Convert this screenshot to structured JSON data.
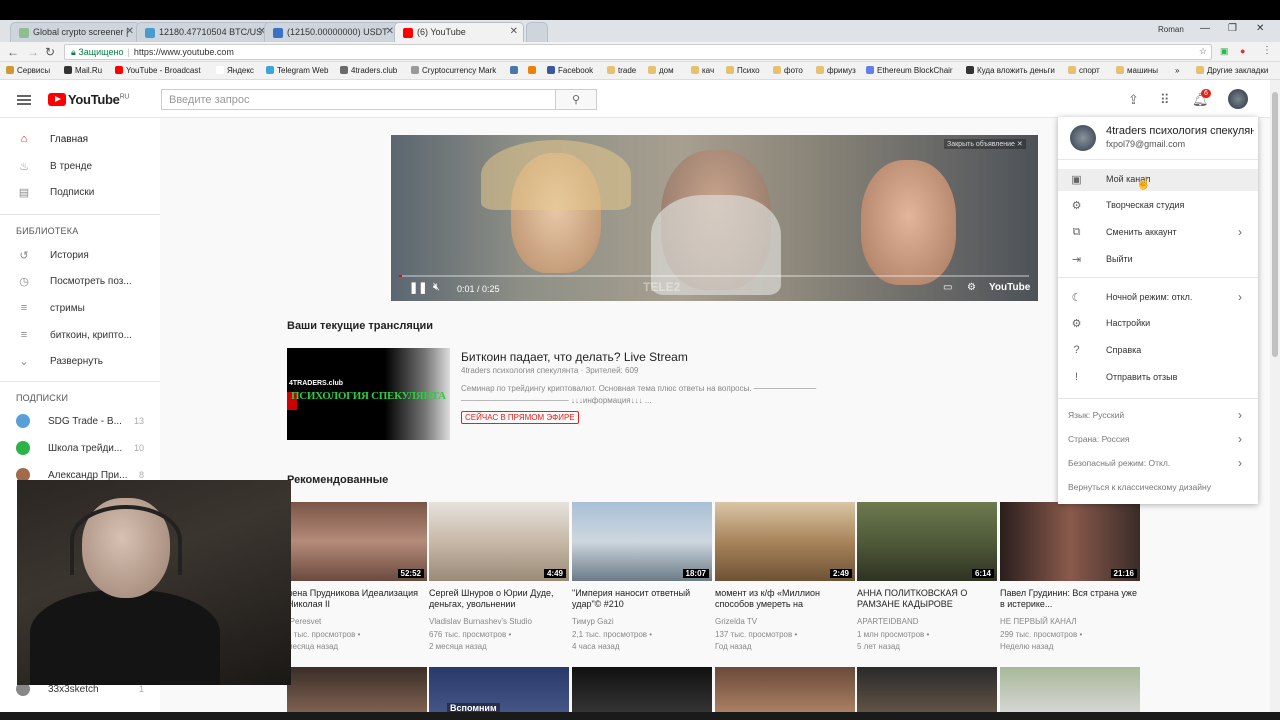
{
  "browser": {
    "tabs": [
      {
        "title": "Global crypto screener |",
        "color": "#8fbf8f"
      },
      {
        "title": "12180.47710504 BTC/US",
        "color": "#4a9bd1"
      },
      {
        "title": "(12150.00000000) USDT",
        "color": "#3b70c4"
      },
      {
        "title": "(6) YouTube",
        "color": "#ff0000"
      }
    ],
    "profile_label": "Roman",
    "url_secure": "Защищено",
    "url": "https://www.youtube.com",
    "bookmarks": [
      "Сервисы",
      "Mail.Ru",
      "YouTube - Broadcast",
      "Яндекс",
      "Telegram Web",
      "4traders.club",
      "Cryptocurrency Mark",
      "",
      "",
      "Facebook",
      "trade",
      "дом",
      "кач",
      "Психо",
      "фото",
      "фримуз",
      "Ethereum BlockChair",
      "Куда вложить деньги",
      "спорт",
      "машины",
      "»",
      "Другие закладки"
    ]
  },
  "header": {
    "logo": "YouTube",
    "logo_region": "RU",
    "search_placeholder": "Введите запрос",
    "notif_count": "6"
  },
  "sidebar": {
    "main": [
      {
        "label": "Главная",
        "icon": "home-icon",
        "active": true
      },
      {
        "label": "В тренде",
        "icon": "flame-icon"
      },
      {
        "label": "Подписки",
        "icon": "subscriptions-icon"
      }
    ],
    "library_heading": "БИБЛИОТЕКА",
    "library": [
      {
        "label": "История",
        "icon": "history-icon"
      },
      {
        "label": "Посмотреть поз...",
        "icon": "clock-icon"
      },
      {
        "label": "стримы",
        "icon": "playlist-icon"
      },
      {
        "label": "биткоин, крипто...",
        "icon": "playlist-icon"
      },
      {
        "label": "Развернуть",
        "icon": "chevron-down-icon"
      }
    ],
    "subs_heading": "ПОДПИСКИ",
    "subs": [
      {
        "label": "SDG Trade - B...",
        "count": "13",
        "color": "#5aa0d8"
      },
      {
        "label": "Школа трейди...",
        "count": "10",
        "color": "#2bb34a"
      },
      {
        "label": "Александр При...",
        "count": "8",
        "color": "#a06b4c"
      }
    ],
    "last_sub": {
      "label": "33x3sketch",
      "count": "1"
    }
  },
  "player": {
    "time": "0:01 / 0:25",
    "watermark": "TELE2",
    "ad_label": "Закрыть объявление",
    "brand": "YouTube"
  },
  "live_section": {
    "heading": "Ваши текущие трансляции",
    "thumb_top": "4TRADERS.club",
    "thumb_main": "ПСИХОЛОГИЯ СПЕКУЛЯНТА",
    "title": "Биткоин падает, что делать? Live Stream",
    "meta": "4traders психология спекулянта · Зрителей: 609",
    "desc": "Семинар по трейдингу криптовалют. Основная тема плюс ответы на вопросы. ─────────── ─────────────────── ↓↓↓информация↓↓↓ ...",
    "badge": "СЕЙЧАС В ПРЯМОМ ЭФИРЕ"
  },
  "recommended": {
    "heading": "Рекомендованные",
    "videos": [
      {
        "title": "лена Прудникова Идеализация Николая II",
        "channel": "rPeresvet",
        "views": "7 тыс. просмотров",
        "age": "месяца назад",
        "duration": "52:52",
        "thumb": "#8a5a4a"
      },
      {
        "title": "Сергей Шнуров о Юрии Дуде, деньгах, увольнении",
        "channel": "Vladislav Burnashev's Studio",
        "views": "676 тыс. просмотров",
        "age": "2 месяца назад",
        "duration": "4:49",
        "thumb": "#c9c2b8"
      },
      {
        "title": "\"Империя наносит ответный удар\"© #210",
        "channel": "Тимур Gazi",
        "views": "2,1 тыс. просмотров",
        "age": "4 часа назад",
        "duration": "18:07",
        "thumb": "#8ea6bf"
      },
      {
        "title": "момент из к/ф «Миллион способов умереть на",
        "channel": "Grizelda TV",
        "views": "137 тыс. просмотров",
        "age": "Год назад",
        "duration": "2:49",
        "thumb": "#9a7a55"
      },
      {
        "title": "АННА ПОЛИТКОВСКАЯ О РАМЗАНЕ КАДЫРОВЕ",
        "channel": "APARTEIDBAND",
        "views": "1 млн просмотров",
        "age": "5 лет назад",
        "duration": "6:14",
        "thumb": "#4f5a3a"
      },
      {
        "title": "Павел Грудинин: Вся страна уже в истерике...",
        "channel": "НЕ ПЕРВЫЙ КАНАЛ",
        "views": "299 тыс. просмотров",
        "age": "Неделю назад",
        "duration": "21:16",
        "thumb": "#4a3c38"
      }
    ],
    "second_row": [
      {
        "thumb": "#3a2e28",
        "label": ""
      },
      {
        "thumb": "#283a6a",
        "label": "Вспомним"
      },
      {
        "thumb": "#1a1a1a",
        "label": ""
      },
      {
        "thumb": "#6a4a3a",
        "label": ""
      },
      {
        "thumb": "#2a2a2a",
        "label": ""
      },
      {
        "thumb": "#7a8a6a",
        "label": ""
      }
    ]
  },
  "account_menu": {
    "name": "4traders психология спекулянта",
    "email": "fxpol79@gmail.com",
    "items": [
      {
        "label": "Мой канал",
        "icon": "person-icon",
        "highlighted": true
      },
      {
        "label": "Творческая студия",
        "icon": "gear-icon"
      },
      {
        "label": "Сменить аккаунт",
        "icon": "switch-account-icon",
        "chevron": true
      },
      {
        "label": "Выйти",
        "icon": "exit-icon"
      }
    ],
    "items2": [
      {
        "label": "Ночной режим: откл.",
        "icon": "moon-icon",
        "chevron": true
      },
      {
        "label": "Настройки",
        "icon": "gear-icon"
      },
      {
        "label": "Справка",
        "icon": "help-icon"
      },
      {
        "label": "Отправить отзыв",
        "icon": "feedback-icon"
      }
    ],
    "options": [
      {
        "label": "Язык: Русский",
        "chevron": true
      },
      {
        "label": "Страна: Россия",
        "chevron": true
      },
      {
        "label": "Безопасный режим: Откл.",
        "chevron": true
      },
      {
        "label": "Вернуться к классическому дизайну",
        "chevron": false
      }
    ]
  }
}
